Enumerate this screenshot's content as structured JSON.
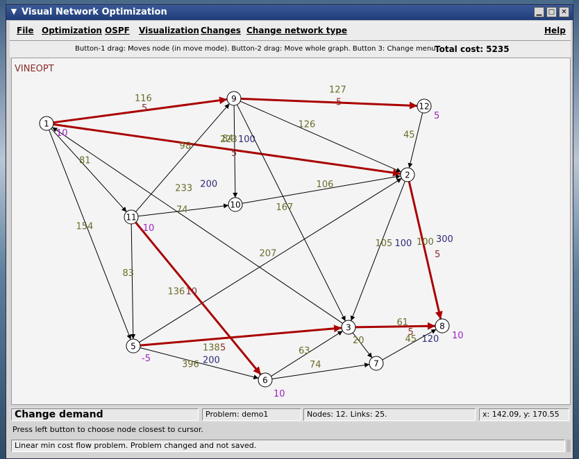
{
  "window": {
    "title": "Visual Network Optimization",
    "window_menu_icon": "chevron-down-icon",
    "controls": {
      "minimize": "minimize-icon",
      "maximize": "maximize-icon",
      "close": "close-icon"
    }
  },
  "menu": {
    "items": [
      "File",
      "Optimization",
      "OSPF",
      "Visualization",
      "Changes",
      "Change network type"
    ],
    "help": "Help"
  },
  "info": {
    "hint": "Button-1 drag: Moves node (in move mode). Button-2 drag: Move whole graph. Button 3: Change menu",
    "total_cost": "Total cost: 5235"
  },
  "graph": {
    "label": "VINEOPT",
    "colors": {
      "flow": "#aa0000",
      "edge": "#000000",
      "cost": "#6b6b2a",
      "capacity": "#2a2a7a",
      "demand": "#a020c0",
      "flow_label": "#8a2a2a",
      "title": "#8b2a2a"
    },
    "nodes": [
      {
        "id": "1",
        "demand": "10"
      },
      {
        "id": "2",
        "demand": ""
      },
      {
        "id": "3",
        "demand": ""
      },
      {
        "id": "5",
        "demand": "-5"
      },
      {
        "id": "6",
        "demand": "10"
      },
      {
        "id": "7",
        "demand": ""
      },
      {
        "id": "8",
        "demand": "10"
      },
      {
        "id": "9",
        "demand": ""
      },
      {
        "id": "10",
        "demand": ""
      },
      {
        "id": "11",
        "demand": "-10"
      },
      {
        "id": "12",
        "demand": "5"
      }
    ],
    "edges": [
      {
        "from": "1",
        "to": "9",
        "cost": "116",
        "cap": "",
        "flow": "5"
      },
      {
        "from": "9",
        "to": "12",
        "cost": "127",
        "cap": "",
        "flow": "5"
      },
      {
        "from": "1",
        "to": "2",
        "cost": "223",
        "cap": "100",
        "flow": "5"
      },
      {
        "from": "12",
        "to": "2",
        "cost": "45",
        "cap": "",
        "flow": ""
      },
      {
        "from": "9",
        "to": "2",
        "cost": "126",
        "cap": "",
        "flow": ""
      },
      {
        "from": "9",
        "to": "10",
        "cost": "84",
        "cap": "",
        "flow": ""
      },
      {
        "from": "11",
        "to": "9",
        "cost": "98",
        "cap": "",
        "flow": ""
      },
      {
        "from": "1",
        "to": "11",
        "cost": "81",
        "cap": "",
        "flow": ""
      },
      {
        "from": "1",
        "to": "5",
        "cost": "154",
        "cap": "",
        "flow": ""
      },
      {
        "from": "11",
        "to": "10",
        "cost": "74",
        "cap": "",
        "flow": ""
      },
      {
        "from": "10",
        "to": "2",
        "cost": "106",
        "cap": "",
        "flow": ""
      },
      {
        "from": "3",
        "to": "1",
        "cost": "233",
        "cap": "200",
        "flow": ""
      },
      {
        "from": "9",
        "to": "3",
        "cost": "167",
        "cap": "",
        "flow": ""
      },
      {
        "from": "2",
        "to": "3",
        "cost": "105",
        "cap": "100",
        "flow": ""
      },
      {
        "from": "2",
        "to": "8",
        "cost": "100",
        "cap": "300",
        "flow": "5"
      },
      {
        "from": "5",
        "to": "2",
        "cost": "207",
        "cap": "",
        "flow": ""
      },
      {
        "from": "11",
        "to": "5",
        "cost": "83",
        "cap": "",
        "flow": ""
      },
      {
        "from": "11",
        "to": "6",
        "cost": "136",
        "cap": "",
        "flow": "10"
      },
      {
        "from": "5",
        "to": "3",
        "cost": "138",
        "cap": "",
        "flow": "5"
      },
      {
        "from": "3",
        "to": "8",
        "cost": "61",
        "cap": "",
        "flow": "5"
      },
      {
        "from": "3",
        "to": "7",
        "cost": "20",
        "cap": "",
        "flow": ""
      },
      {
        "from": "7",
        "to": "8",
        "cost": "45",
        "cap": "120",
        "flow": ""
      },
      {
        "from": "5",
        "to": "6",
        "cost": "396",
        "cap": "200",
        "flow": ""
      },
      {
        "from": "6",
        "to": "3",
        "cost": "63",
        "cap": "",
        "flow": ""
      },
      {
        "from": "6",
        "to": "7",
        "cost": "74",
        "cap": "",
        "flow": ""
      }
    ]
  },
  "status": {
    "mode": "Change demand",
    "problem": "Problem: demo1",
    "counts": "Nodes: 12. Links: 25.",
    "coords": "x: 142.09, y: 170.55",
    "prompt": "Press left button to choose node closest to cursor.",
    "message": "Linear min cost flow problem. Problem changed and not saved."
  }
}
